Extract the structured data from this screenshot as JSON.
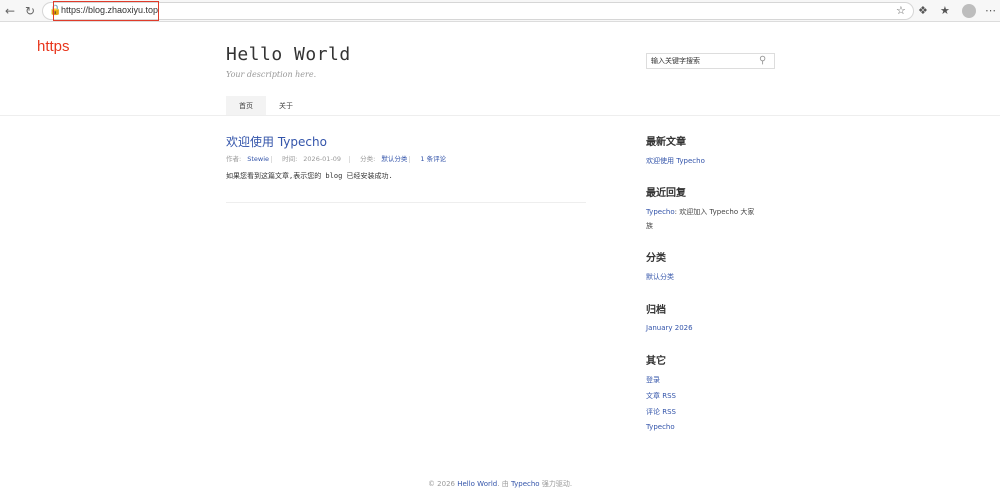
{
  "browser": {
    "url": "https://blog.zhaoxiyu.top"
  },
  "annotation": {
    "label": "https"
  },
  "header": {
    "site_title": "Hello World",
    "description": "Your description here.",
    "search_placeholder": "输入关键字搜索",
    "nav": [
      "首页",
      "关于"
    ]
  },
  "post": {
    "title": "欢迎使用 Typecho",
    "author_label": "作者:",
    "author": "Stewie",
    "time_label": "时间:",
    "time": "2026-01-09",
    "category_label": "分类:",
    "category": "默认分类",
    "comments": "1 条评论",
    "body": "如果您看到这篇文章,表示您的 blog 已经安装成功."
  },
  "sidebar": {
    "recent_posts_heading": "最新文章",
    "recent_posts": [
      "欢迎使用 Typecho"
    ],
    "recent_comments_heading": "最近回复",
    "recent_comment_author": "Typecho",
    "recent_comment_text_line1": ": 欢迎加入 Typecho 大家",
    "recent_comment_text_line2": "族",
    "categories_heading": "分类",
    "categories": [
      "默认分类"
    ],
    "archives_heading": "归档",
    "archives": [
      "January 2026"
    ],
    "other_heading": "其它",
    "other": [
      "登录",
      "文章 RSS",
      "评论 RSS",
      "Typecho"
    ]
  },
  "footer": {
    "copyright": "© 2026",
    "site": "Hello World",
    "by": ". 由",
    "engine": "Typecho",
    "powered": "强力驱动."
  },
  "colors": {
    "link": "#3354aa",
    "annotation": "#e8361d"
  }
}
